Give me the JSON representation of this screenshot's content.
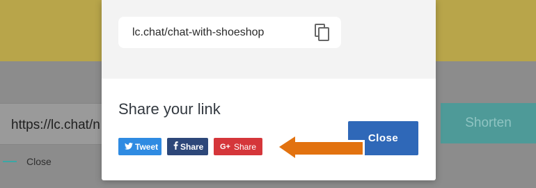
{
  "background": {
    "url_input_value": "https://lc.chat/n",
    "shorten_label": "Shorten",
    "close_label": "Close"
  },
  "modal": {
    "link_value": "lc.chat/chat-with-shoeshop",
    "share_title": "Share your link",
    "buttons": {
      "tweet": "Tweet",
      "facebook": "Share",
      "google_icon": "G+",
      "google": "Share"
    },
    "close_label": "Close"
  },
  "icons": {
    "copy": "copy-icon",
    "twitter": "twitter-icon",
    "facebook": "facebook-icon",
    "google_plus": "google-plus-icon"
  },
  "colors": {
    "tweet": "#2f8be2",
    "facebook": "#2d4779",
    "google": "#d5363a",
    "close": "#2f68b8",
    "arrow": "#e2720f"
  }
}
